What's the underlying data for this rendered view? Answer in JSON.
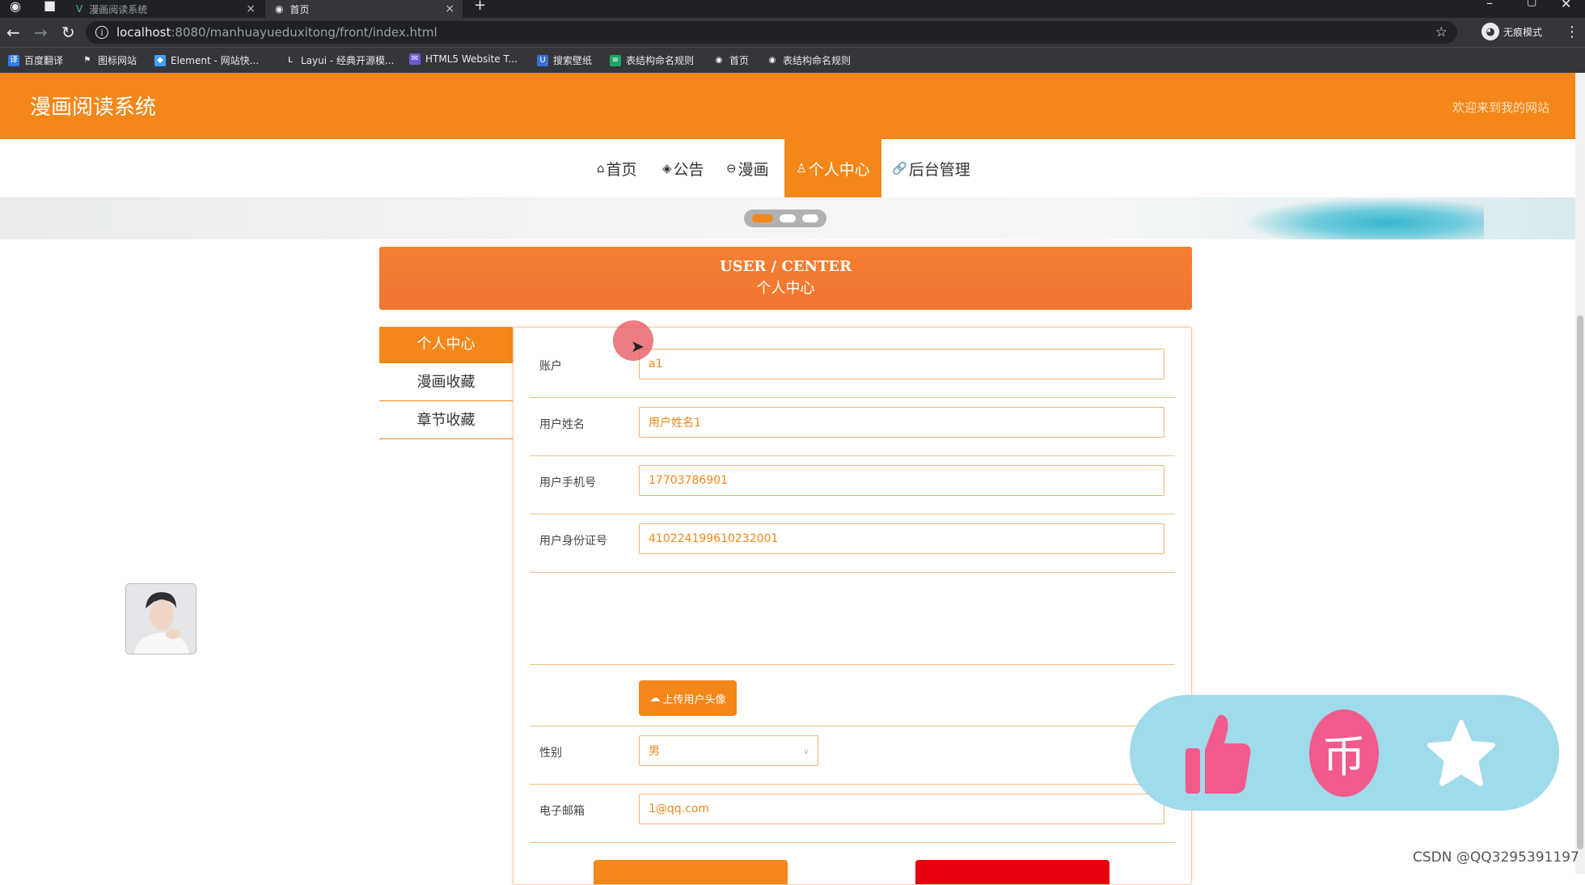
{
  "browser": {
    "tabs": [
      {
        "title": "漫画阅读系统",
        "close": "×"
      },
      {
        "title": "首页",
        "close": "×"
      }
    ],
    "new_tab": "+",
    "url_host": "localhost",
    "url_path": ":8080/manhuayueduxitong/front/index.html",
    "incognito_label": "无痕模式",
    "bookmarks": [
      "百度翻译",
      "图标网站",
      "Element - 网站快...",
      "Layui - 经典开源模...",
      "HTML5 Website T...",
      "搜索壁纸",
      "表结构命名规则",
      "首页",
      "表结构命名规则"
    ]
  },
  "header": {
    "site_title": "漫画阅读系统",
    "welcome": "欢迎来到我的网站"
  },
  "menu": [
    {
      "icon": "⌂",
      "label": "首页"
    },
    {
      "icon": "◈",
      "label": "公告"
    },
    {
      "icon": "⊖",
      "label": "漫画"
    },
    {
      "icon": "♙",
      "label": "个人中心"
    },
    {
      "icon": "🔗",
      "label": "后台管理"
    }
  ],
  "user_center": {
    "title_en": "USER / CENTER",
    "title_cn": "个人中心"
  },
  "sidebar": {
    "items": [
      {
        "label": "个人中心"
      },
      {
        "label": "漫画收藏"
      },
      {
        "label": "章节收藏"
      }
    ]
  },
  "form": {
    "account_label": "账户",
    "account_value": "a1",
    "name_label": "用户姓名",
    "name_value": "用户姓名1",
    "phone_label": "用户手机号",
    "phone_value": "17703786901",
    "idcard_label": "用户身份证号",
    "idcard_value": "410224199610232001",
    "upload_label": "上传用户头像",
    "gender_label": "性别",
    "gender_value": "男",
    "email_label": "电子邮箱",
    "email_value": "1@qq.com"
  },
  "watermark": "CSDN @QQ3295391197",
  "colors": {
    "accent": "#f48719",
    "uc_header": "#f57f31",
    "danger": "#e8000f",
    "overlay": "#9fdbea",
    "overlay_icon": "#f25a8c"
  }
}
